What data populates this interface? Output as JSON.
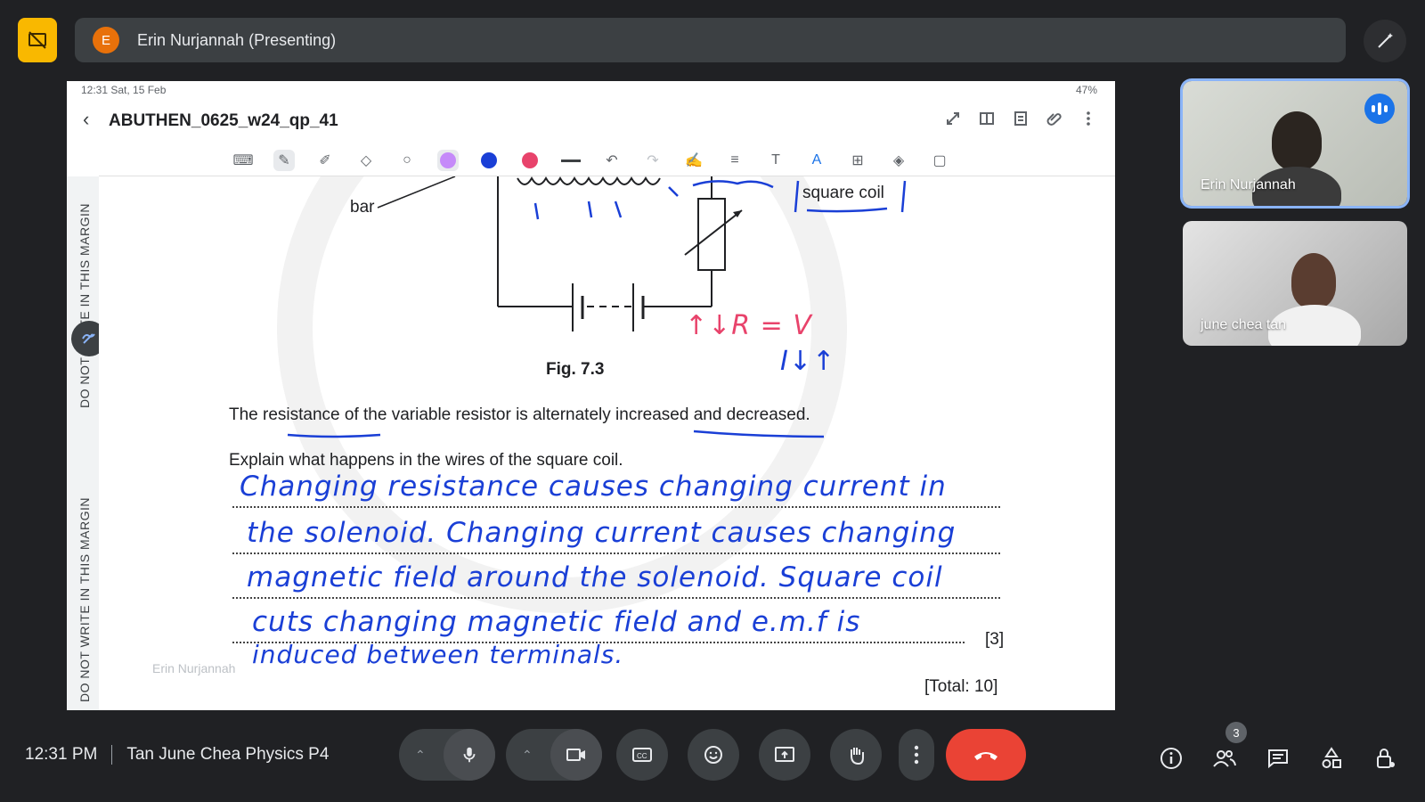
{
  "presenter": {
    "avatar_letter": "E",
    "label": "Erin Nurjannah (Presenting)"
  },
  "tablet": {
    "status_left": "12:31  Sat, 15 Feb",
    "status_right": "47%",
    "doc_title": "ABUTHEN_0625_w24_qp_41",
    "pen_colors": [
      "#c58af9",
      "#1a3fd6",
      "#e8436b"
    ]
  },
  "paper": {
    "margin_text_top": "DO NOT WRITE IN THIS MARGIN",
    "margin_text_bottom": "DO NOT WRITE IN THIS MARGIN",
    "label_bar": "bar",
    "label_square_coil": "square coil",
    "fig_caption": "Fig. 7.3",
    "statement": "The resistance of the variable resistor is alternately increased and decreased.",
    "question": "Explain what happens in the wires of the square coil.",
    "marks": "[3]",
    "total": "[Total: 10]",
    "formula_top": "↑↓R = V",
    "formula_bottom": "I↓↑",
    "answer_lines": [
      "Changing resistance causes changing current in",
      "the solenoid. Changing current causes changing",
      "magnetic field around the solenoid. Square coil",
      "cuts changing magnetic field and e.m.f is",
      "induced between terminals."
    ],
    "overlay_name": "Erin Nurjannah"
  },
  "participants": [
    {
      "name": "Erin Nurjannah",
      "speaking": true
    },
    {
      "name": "june chea tan",
      "speaking": false
    }
  ],
  "bottom": {
    "time": "12:31 PM",
    "meeting": "Tan June Chea Physics P4",
    "people_count": "3"
  },
  "colors": {
    "background": "#202124",
    "accent": "#1a73e8",
    "end_call": "#ea4335",
    "ink_blue": "#1a3fd6",
    "ink_pink": "#e8436b",
    "self_tile": "#f9b800"
  }
}
